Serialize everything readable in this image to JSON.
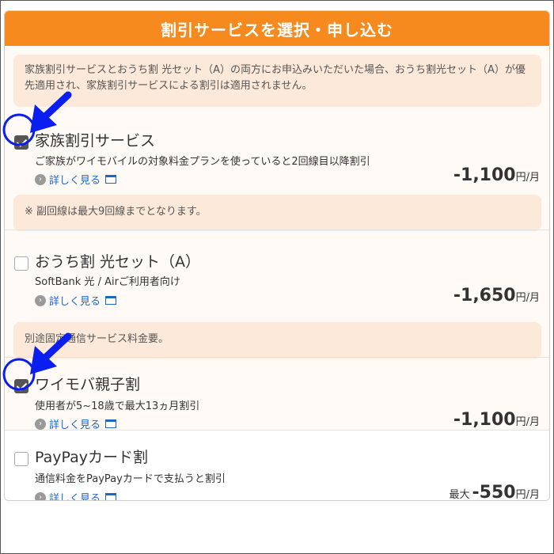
{
  "header": {
    "title": "割引サービスを選択・申し込む"
  },
  "top_note": {
    "text": "家族割引サービスとおうち割 光セット（A）の両方にお申込みいただいた場合、おうち割光セット（A）が優先適用され、家族割引サービスによる割引は適用されません。"
  },
  "items": [
    {
      "title": "家族割引サービス",
      "desc": "ご家族がワイモバイルの対象料金プランを使っていると2回線目以降割引",
      "more": "詳しく見る",
      "price_prefix": "",
      "price": "-1,100",
      "unit": "円/月",
      "checked": true,
      "note": "※ 副回線は最大9回線までとなります。"
    },
    {
      "title": "おうち割 光セット（A）",
      "desc": "SoftBank 光 / Airご利用者向け",
      "more": "詳しく見る",
      "price_prefix": "",
      "price": "-1,650",
      "unit": "円/月",
      "checked": false,
      "note": "別途固定通信サービス料金要。"
    },
    {
      "title": "ワイモバ親子割",
      "desc": "使用者が5~18歳で最大13ヵ月割引",
      "more": "詳しく見る",
      "price_prefix": "",
      "price": "-1,100",
      "unit": "円/月",
      "checked": true
    },
    {
      "title": "PayPayカード割",
      "desc": "通信料金をPayPayカードで支払うと割引",
      "more": "詳しく見る",
      "price_prefix": "最大",
      "price": "-550",
      "unit": "円/月",
      "checked": false
    }
  ],
  "annotations": {
    "arrow_color": "#0a1ef0",
    "circle_color": "#0a1ef0"
  }
}
